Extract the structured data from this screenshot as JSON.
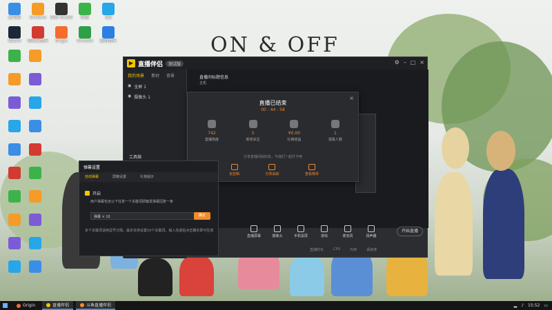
{
  "desktop": {
    "wallpaper_title": "ON & OFF",
    "icons": [
      {
        "label": "此电脑",
        "color": "#3a8ee6"
      },
      {
        "label": "Grafana",
        "color": "#f59b28"
      },
      {
        "label": "OBS Studio",
        "color": "#333333"
      },
      {
        "label": "微信",
        "color": "#3cb34a"
      },
      {
        "label": "QQ",
        "color": "#27a6e8"
      },
      {
        "label": "Steam",
        "color": "#1b2838"
      },
      {
        "label": "网易云音乐",
        "color": "#d33a31"
      },
      {
        "label": "Origin",
        "color": "#f56c2d"
      },
      {
        "label": "Chrome",
        "color": "#2e9e47"
      },
      {
        "label": "酷狗音乐",
        "color": "#2d7ee3"
      }
    ]
  },
  "app": {
    "name": "直播伴侣",
    "version_badge": "测试版",
    "scene_tabs": [
      "我的场景",
      "素材",
      "背景"
    ],
    "scenes": [
      "全屏 1",
      "摄像头 1"
    ],
    "toolbox_label": "工具箱",
    "room_title": "直播间标题信息",
    "room_sub": "主机",
    "bottom_items": [
      "直播屏幕",
      "摄像头",
      "手机投屏",
      "游戏",
      "麦克风",
      "扬声器"
    ],
    "start_label": "开始直播",
    "status": [
      "直播时长",
      "CPU",
      "内存",
      "丢帧率"
    ]
  },
  "end_dialog": {
    "title": "直播已结束",
    "duration": "00 : 44 : 58",
    "stats": [
      {
        "value": "742",
        "label": "直播热度"
      },
      {
        "value": "5",
        "label": "新增关注"
      },
      {
        "value": "¥0.00",
        "label": "礼物收益"
      },
      {
        "value": "1",
        "label": "观看人数"
      }
    ],
    "share_text": "分享直播间给好友，与他们一起打卡吧",
    "actions": [
      "去剪辑",
      "分享战绩",
      "查看榜单"
    ],
    "close_icon": "×"
  },
  "settings_window": {
    "title": "弹幕设置",
    "tabs": [
      "自动弹幕",
      "屏蔽设置",
      "礼物提示"
    ],
    "checkbox_label": "开启",
    "description": "用户弹幕包含以下任意一个关键词即触发弹幕回复一条",
    "input_value": "弹幕 × 10",
    "confirm_label": "确定",
    "note": "多个关键词请用逗号分隔，最多支持设置10个关键词，输入完成后点击确定即可生效"
  },
  "taskbar": {
    "apps": [
      {
        "label": "Origin",
        "color": "#f56c2d"
      },
      {
        "label": "直播伴侣",
        "color": "#f3c500"
      },
      {
        "label": "斗鱼直播伴侣",
        "color": "#f38b2c"
      }
    ],
    "clock": "15:52"
  }
}
